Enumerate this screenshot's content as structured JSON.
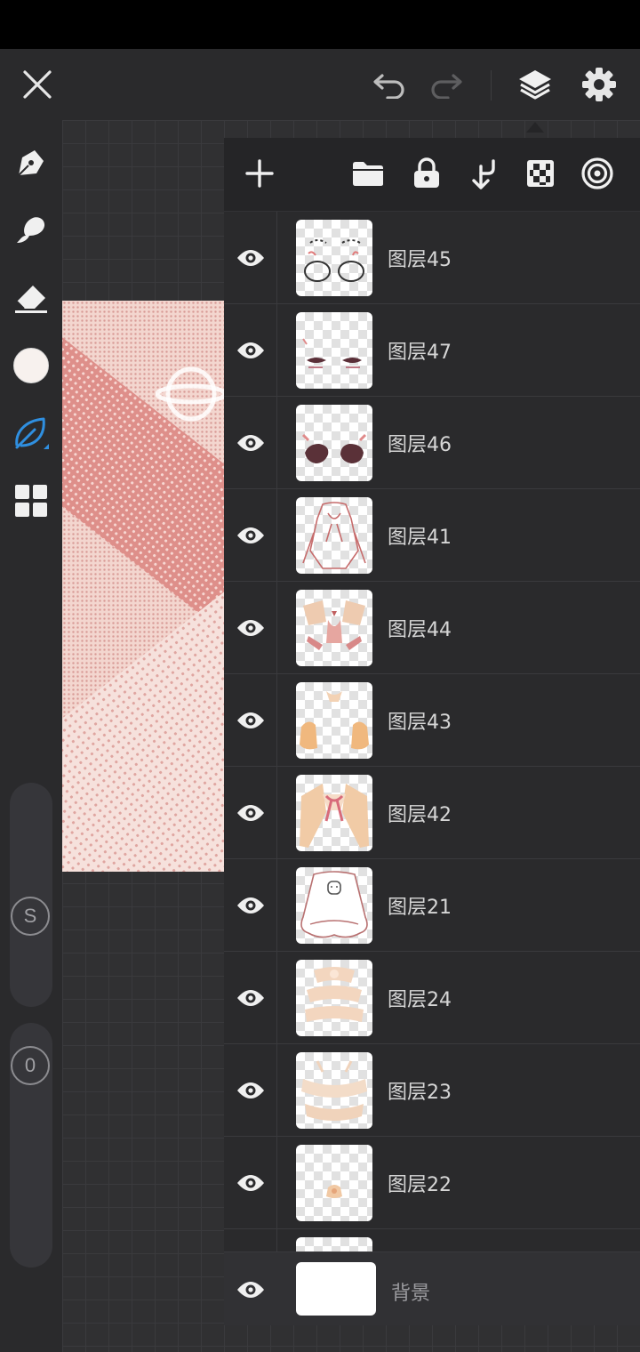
{
  "app": {
    "accent": "#2f8fe0",
    "background": "#2a2a2c"
  },
  "topbar": {
    "close_icon": "close-icon",
    "undo_icon": "undo-icon",
    "redo_icon": "redo-icon",
    "layers_icon": "layers-icon",
    "settings_icon": "gear-icon"
  },
  "tools": [
    {
      "name": "pen",
      "icon": "pen-nib-icon"
    },
    {
      "name": "smudge",
      "icon": "smudge-icon"
    },
    {
      "name": "eraser",
      "icon": "eraser-icon"
    },
    {
      "name": "color",
      "icon": "color-swatch",
      "color": "#f7f1ee"
    },
    {
      "name": "selection",
      "icon": "leaf-lasso-icon",
      "active": true
    },
    {
      "name": "gallery",
      "icon": "grid-icon"
    }
  ],
  "sliders": {
    "size_label": "S",
    "opacity_label": "0"
  },
  "layers_panel": {
    "actions": [
      "add-layer-icon",
      "folder-icon",
      "lock-icon",
      "merge-down-icon",
      "checker-icon",
      "target-icon"
    ],
    "layers": [
      {
        "name": "图层45",
        "visible": true
      },
      {
        "name": "图层47",
        "visible": true
      },
      {
        "name": "图层46",
        "visible": true
      },
      {
        "name": "图层41",
        "visible": true
      },
      {
        "name": "图层44",
        "visible": true
      },
      {
        "name": "图层43",
        "visible": true
      },
      {
        "name": "图层42",
        "visible": true
      },
      {
        "name": "图层21",
        "visible": true
      },
      {
        "name": "图层24",
        "visible": true
      },
      {
        "name": "图层23",
        "visible": true
      },
      {
        "name": "图层22",
        "visible": true
      },
      {
        "name": "",
        "visible": true
      }
    ],
    "background_layer": {
      "name": "背景",
      "visible": true
    }
  }
}
